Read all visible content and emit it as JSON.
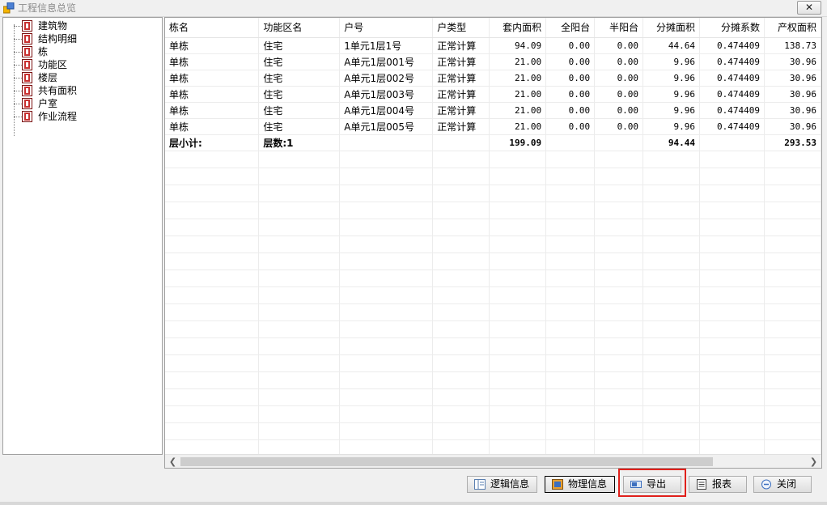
{
  "window": {
    "title": "工程信息总览",
    "close_label": "✕"
  },
  "tree": {
    "items": [
      {
        "label": "建筑物",
        "icon": "building-doc-icon"
      },
      {
        "label": "结构明细",
        "icon": "building-doc-icon"
      },
      {
        "label": "栋",
        "icon": "building-doc-icon"
      },
      {
        "label": "功能区",
        "icon": "building-doc-icon"
      },
      {
        "label": "楼层",
        "icon": "building-doc-icon"
      },
      {
        "label": "共有面积",
        "icon": "building-doc-icon"
      },
      {
        "label": "户室",
        "icon": "room-doc-icon"
      },
      {
        "label": "作业流程",
        "icon": "building-doc-icon"
      }
    ]
  },
  "grid": {
    "columns": [
      "栋名",
      "功能区名",
      "户号",
      "户类型",
      "套内面积",
      "全阳台",
      "半阳台",
      "分摊面积",
      "分摊系数",
      "产权面积"
    ],
    "rows": [
      [
        "单栋",
        "住宅",
        "1单元1层1号",
        "正常计算",
        "94.09",
        "0.00",
        "0.00",
        "44.64",
        "0.474409",
        "138.73"
      ],
      [
        "单栋",
        "住宅",
        "A单元1层001号",
        "正常计算",
        "21.00",
        "0.00",
        "0.00",
        "9.96",
        "0.474409",
        "30.96"
      ],
      [
        "单栋",
        "住宅",
        "A单元1层002号",
        "正常计算",
        "21.00",
        "0.00",
        "0.00",
        "9.96",
        "0.474409",
        "30.96"
      ],
      [
        "单栋",
        "住宅",
        "A单元1层003号",
        "正常计算",
        "21.00",
        "0.00",
        "0.00",
        "9.96",
        "0.474409",
        "30.96"
      ],
      [
        "单栋",
        "住宅",
        "A单元1层004号",
        "正常计算",
        "21.00",
        "0.00",
        "0.00",
        "9.96",
        "0.474409",
        "30.96"
      ],
      [
        "单栋",
        "住宅",
        "A单元1层005号",
        "正常计算",
        "21.00",
        "0.00",
        "0.00",
        "9.96",
        "0.474409",
        "30.96"
      ]
    ],
    "subtotal": [
      "层小计:",
      "层数:1",
      "",
      "",
      "199.09",
      "",
      "",
      "94.44",
      "",
      "293.53"
    ]
  },
  "buttons": {
    "logic": "逻辑信息",
    "physical": "物理信息",
    "export": "导出",
    "report": "报表",
    "close": "关闭"
  },
  "colors": {
    "highlight": "#e0201b",
    "accent": "#3c6fbf"
  }
}
